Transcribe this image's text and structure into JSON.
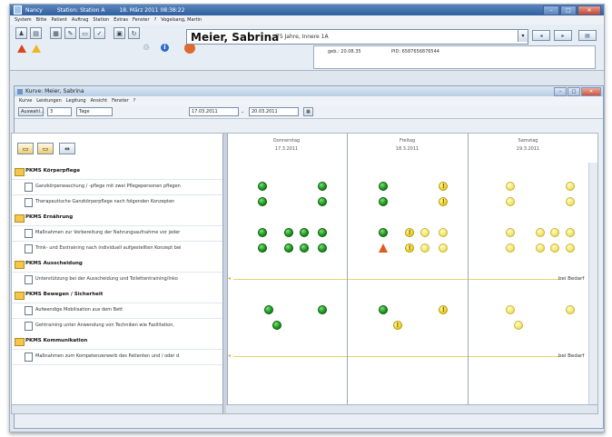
{
  "window": {
    "app": "Nancy",
    "station": "Station: Station A",
    "datetime": "18. März 2011 08:38:22",
    "user": "Vogelsang, Martin"
  },
  "menu": [
    "System",
    "Bitte",
    "Patient",
    "Auftrag",
    "Station",
    "Extras",
    "Fenster",
    "?"
  ],
  "patient": {
    "name": "Meier, Sabrina",
    "info": "75 Jahre, Innere 1A",
    "dob": "geb.: 20.08.35",
    "pid": "PID: 6587656876544"
  },
  "inner": {
    "title": "Kurve: Meier, Sabrina",
    "menu": [
      "Kurve",
      "Leistungen",
      "Legitung",
      "Ansicht",
      "Fenster",
      "?"
    ]
  },
  "controls": {
    "auswahl": "Auswahl...",
    "count": "3",
    "unit": "Tage",
    "from": "17.03.2011",
    "dash": "-",
    "to": "20.03.2011"
  },
  "days": [
    {
      "weekday": "Donnerstag",
      "date": "17.3.2011"
    },
    {
      "weekday": "Freitag",
      "date": "18.3.2011"
    },
    {
      "weekday": "Samstag",
      "date": "19.3.2011"
    }
  ],
  "rows": [
    {
      "type": "group",
      "label": "PKMS Körperpflege"
    },
    {
      "type": "item",
      "label": "Ganzkörperwaschung / -pflege mit zwei Pflegepersonen pflegen",
      "markers": [
        {
          "k": "g",
          "d": 0.3
        },
        {
          "k": "g",
          "d": 0.8
        },
        {
          "k": "g",
          "d": 1.3
        },
        {
          "k": "a",
          "d": 1.8
        },
        {
          "k": "y",
          "d": 2.35
        },
        {
          "k": "y",
          "d": 2.85
        }
      ]
    },
    {
      "type": "item",
      "label": "Therapeutische Ganzkörperpflege nach folgenden Konzepten",
      "markers": [
        {
          "k": "g",
          "d": 0.3
        },
        {
          "k": "g",
          "d": 0.8
        },
        {
          "k": "g",
          "d": 1.3
        },
        {
          "k": "a",
          "d": 1.8
        },
        {
          "k": "y",
          "d": 2.35
        },
        {
          "k": "y",
          "d": 2.85
        }
      ]
    },
    {
      "type": "group",
      "label": "PKMS Ernährung"
    },
    {
      "type": "item",
      "label": "Maßnahmen zur Vorbereitung der Nahrungsaufnahme vor jeder",
      "markers": [
        {
          "k": "g",
          "d": 0.3
        },
        {
          "k": "g",
          "d": 0.52
        },
        {
          "k": "g",
          "d": 0.65
        },
        {
          "k": "g",
          "d": 0.8
        },
        {
          "k": "g",
          "d": 1.3
        },
        {
          "k": "a",
          "d": 1.52
        },
        {
          "k": "y",
          "d": 1.65
        },
        {
          "k": "y",
          "d": 1.8
        },
        {
          "k": "y",
          "d": 2.35
        },
        {
          "k": "y",
          "d": 2.6
        },
        {
          "k": "y",
          "d": 2.72
        },
        {
          "k": "y",
          "d": 2.85
        }
      ]
    },
    {
      "type": "item",
      "label": "Trink- und Esstraining nach individuell aufgestellten Konzept bei",
      "markers": [
        {
          "k": "g",
          "d": 0.3
        },
        {
          "k": "g",
          "d": 0.52
        },
        {
          "k": "g",
          "d": 0.65
        },
        {
          "k": "g",
          "d": 0.8
        },
        {
          "k": "t",
          "d": 1.3
        },
        {
          "k": "a",
          "d": 1.52
        },
        {
          "k": "y",
          "d": 1.65
        },
        {
          "k": "y",
          "d": 1.8
        },
        {
          "k": "y",
          "d": 2.35
        },
        {
          "k": "y",
          "d": 2.6
        },
        {
          "k": "y",
          "d": 2.72
        },
        {
          "k": "y",
          "d": 2.85
        }
      ]
    },
    {
      "type": "group",
      "label": "PKMS Ausscheidung"
    },
    {
      "type": "item",
      "label": "Unterstützung bei der Ausscheidung und Toilettentraining/Inko",
      "bedarf": "bei Bedarf"
    },
    {
      "type": "group",
      "label": "PKMS Bewegen / Sicherheit"
    },
    {
      "type": "item",
      "label": "Aufwendige Mobilisation aus dem Bett",
      "markers": [
        {
          "k": "g",
          "d": 0.35
        },
        {
          "k": "g",
          "d": 0.8
        },
        {
          "k": "g",
          "d": 1.3
        },
        {
          "k": "a",
          "d": 1.8
        },
        {
          "k": "y",
          "d": 2.35
        },
        {
          "k": "y",
          "d": 2.85
        }
      ]
    },
    {
      "type": "item",
      "label": "Gehtraining unter Anwendung von Techniken wie Fazilitation,",
      "markers": [
        {
          "k": "g",
          "d": 0.42
        },
        {
          "k": "a",
          "d": 1.42
        },
        {
          "k": "y",
          "d": 2.42
        }
      ]
    },
    {
      "type": "group",
      "label": "PKMS Kommunikation"
    },
    {
      "type": "item",
      "label": "Maßnahmen zum Kompetenzerwerb des Patienten und / oder d",
      "bedarf": "bei Bedarf"
    }
  ],
  "icons": {
    "alert": "!"
  }
}
